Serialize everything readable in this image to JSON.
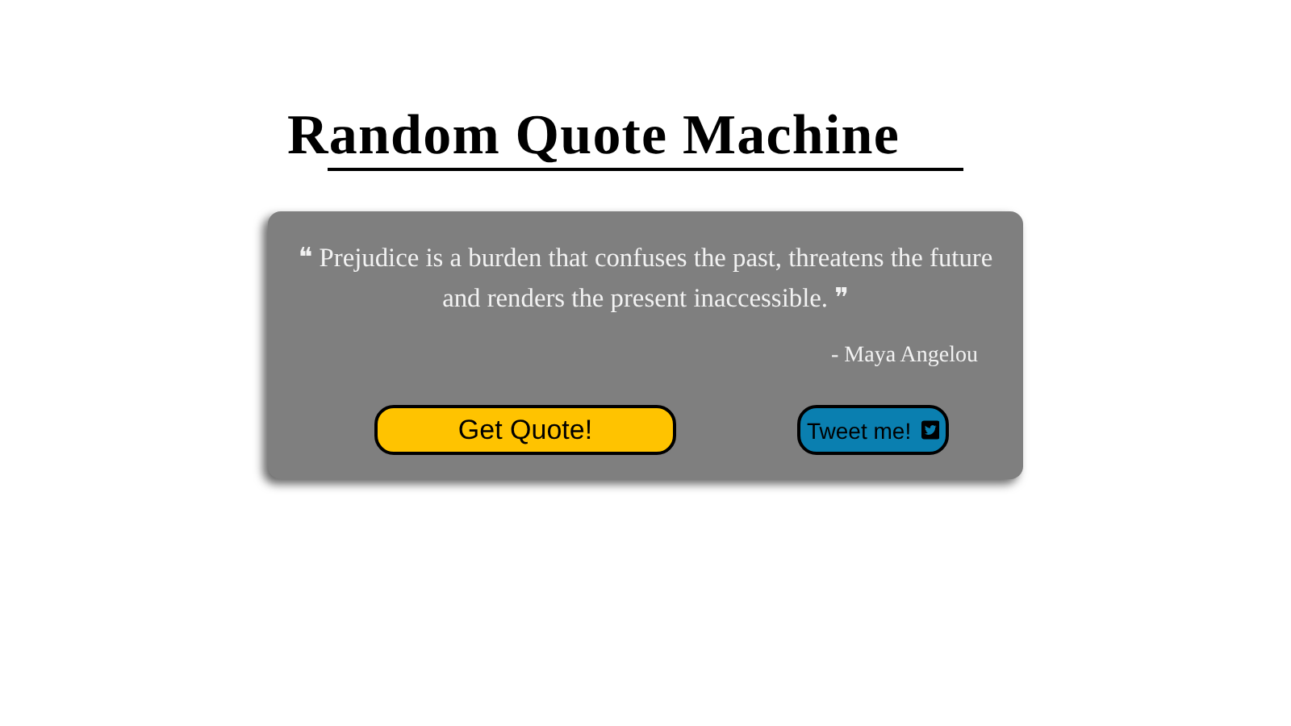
{
  "title": "Random Quote Machine",
  "quote": {
    "text": "❝ Prejudice is a burden that confuses the past, threatens the future and renders the present inaccessible. ❞",
    "author": "- Maya Angelou"
  },
  "buttons": [
    {
      "kind": "quote",
      "label": "Get Quote!"
    },
    {
      "kind": "tweet",
      "label": "Tweet me!"
    }
  ]
}
